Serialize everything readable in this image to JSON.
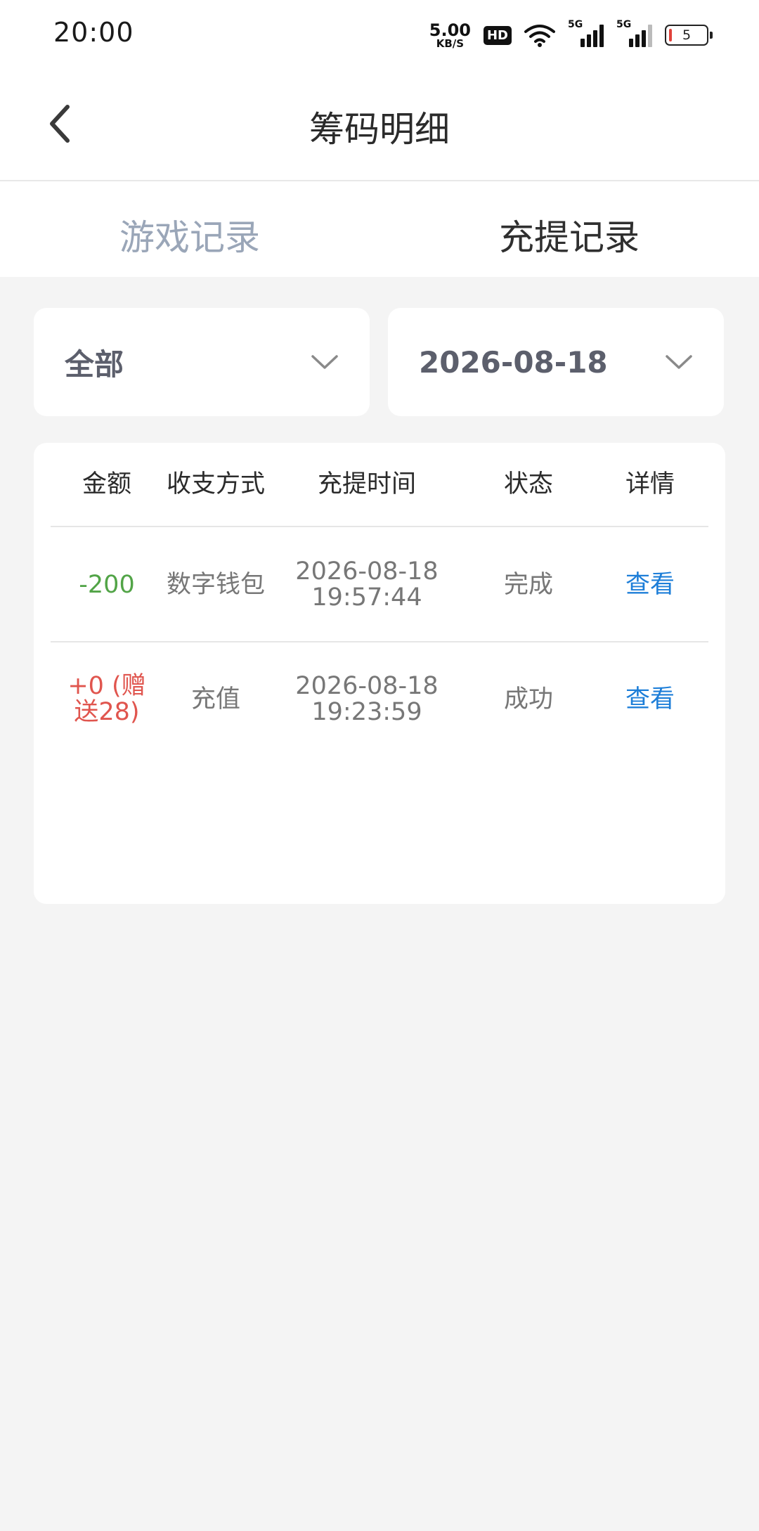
{
  "status_bar": {
    "time": "20:00",
    "net_speed_value": "5.00",
    "net_speed_unit": "KB/S",
    "hd_badge": "HD",
    "signal_1_label": "5G",
    "signal_2_label": "5G",
    "battery_level": "5"
  },
  "header": {
    "title": "筹码明细"
  },
  "tabs": [
    {
      "label": "游戏记录",
      "active": false
    },
    {
      "label": "充提记录",
      "active": true
    }
  ],
  "filters": {
    "type_value": "全部",
    "date_value": "2026-08-18"
  },
  "table": {
    "headers": [
      "金额",
      "收支方式",
      "充提时间",
      "状态",
      "详情"
    ],
    "rows": [
      {
        "amount_line1": "-200",
        "amount_line2": "",
        "method": "数字钱包",
        "date": "2026-08-18",
        "time": "19:57:44",
        "status": "完成",
        "detail": "查看"
      },
      {
        "amount_line1": "+0 (赠",
        "amount_line2": "送28)",
        "method": "充值",
        "date": "2026-08-18",
        "time": "19:23:59",
        "status": "成功",
        "detail": "查看"
      }
    ]
  },
  "colors": {
    "negative_amount": "#52a447",
    "positive_amount": "#e0554e",
    "link": "#1d7ed8",
    "inactive_tab": "#9aa6b8"
  }
}
